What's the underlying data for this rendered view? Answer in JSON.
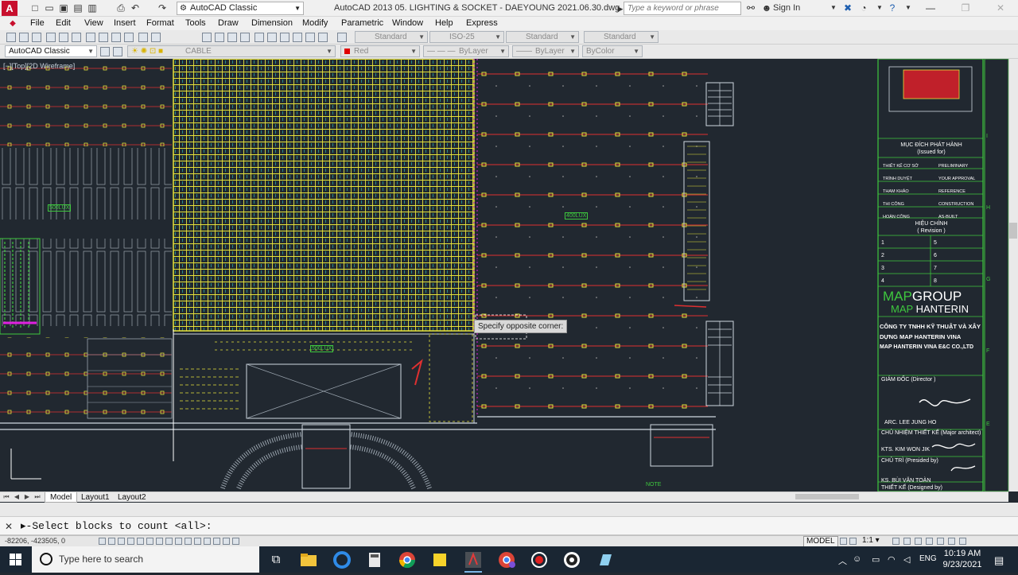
{
  "titlebar": {
    "workspace": "AutoCAD Classic",
    "title": "AutoCAD 2013    05. LIGHTING & SOCKET - DAEYOUNG 2021.06.30.dwg",
    "search_placeholder": "Type a keyword or phrase",
    "signin": "Sign In"
  },
  "menu": [
    "File",
    "Edit",
    "View",
    "Insert",
    "Format",
    "Tools",
    "Draw",
    "Dimension",
    "Modify",
    "Parametric",
    "Window",
    "Help",
    "Express"
  ],
  "toolbar1": {
    "text_style": "Standard",
    "dim_style": "ISO-25",
    "table_style": "Standard",
    "mleader_style": "Standard"
  },
  "toolbar2": {
    "workspace": "AutoCAD Classic",
    "layer": "CABLE",
    "color": "Red",
    "color_hex": "#e00000",
    "linetype": "ByLayer",
    "lineweight": "ByLayer",
    "plotstyle": "ByColor"
  },
  "viewport_label": "[−][Top][2D Wireframe]",
  "cursor_tip": "Specify opposite corner:",
  "drawing_text": {
    "lux1": "500LUX",
    "lux2": "400LUX",
    "lux3": "500LUX",
    "note": "NOTE"
  },
  "title_block": {
    "issued_vn": "MỤC ĐÍCH PHÁT HÀNH",
    "issued_en": "(Issued for)",
    "issue_rows": [
      {
        "vn": "THIẾT KẾ CƠ SỞ",
        "en": "PRELIMINARY"
      },
      {
        "vn": "TRÌNH DUYỆT",
        "en": "YOUR APPROVAL"
      },
      {
        "vn": "THAM KHẢO",
        "en": "REFERENCE"
      },
      {
        "vn": "THI CÔNG",
        "en": "CONSTRUCTION"
      },
      {
        "vn": "HOÀN CÔNG",
        "en": "AS-BUILT"
      }
    ],
    "revision_vn": "HIỆU CHỈNH",
    "revision_en": "( Revision )",
    "rev_left": [
      "1",
      "2",
      "3",
      "4"
    ],
    "rev_right": [
      "5",
      "6",
      "7",
      "8"
    ],
    "brand1_a": "MAP",
    "brand1_b": "GROUP",
    "brand2_a": "MAP",
    "brand2_b": "HANTERIN",
    "company_vn1": "CÔNG TY TNHH KỸ THUẬT VÀ XÂY",
    "company_vn2": "DỰNG MAP HANTERIN VINA",
    "company_en": "MAP HANTERIN VINA E&C CO.,LTD",
    "director_label": "GIÁM ĐỐC  (Director )",
    "director_name": "ARC. LEE JUNG HO",
    "chief_label": "CHỦ NHIỆM THIẾT KẾ (Major architect)",
    "chief_name": "KTS. KIM WON JIK",
    "presided_label": "CHỦ TRÌ  (Presided by)",
    "presided_name": "KS. BÙI VĂN TOÀN",
    "designed_label": "THIẾT KẾ  (Designed by)"
  },
  "grid_marks": [
    "I",
    "H",
    "G",
    "F",
    "E"
  ],
  "tabs": [
    "Model",
    "Layout1",
    "Layout2"
  ],
  "command": "Select blocks to count <all>:",
  "status": {
    "coords": "-82206, -423505, 0",
    "model": "MODEL",
    "scale": "1:1"
  },
  "taskbar": {
    "search_placeholder": "Type here to search",
    "lang": "ENG",
    "time": "10:19 AM",
    "date": "9/23/2021"
  }
}
